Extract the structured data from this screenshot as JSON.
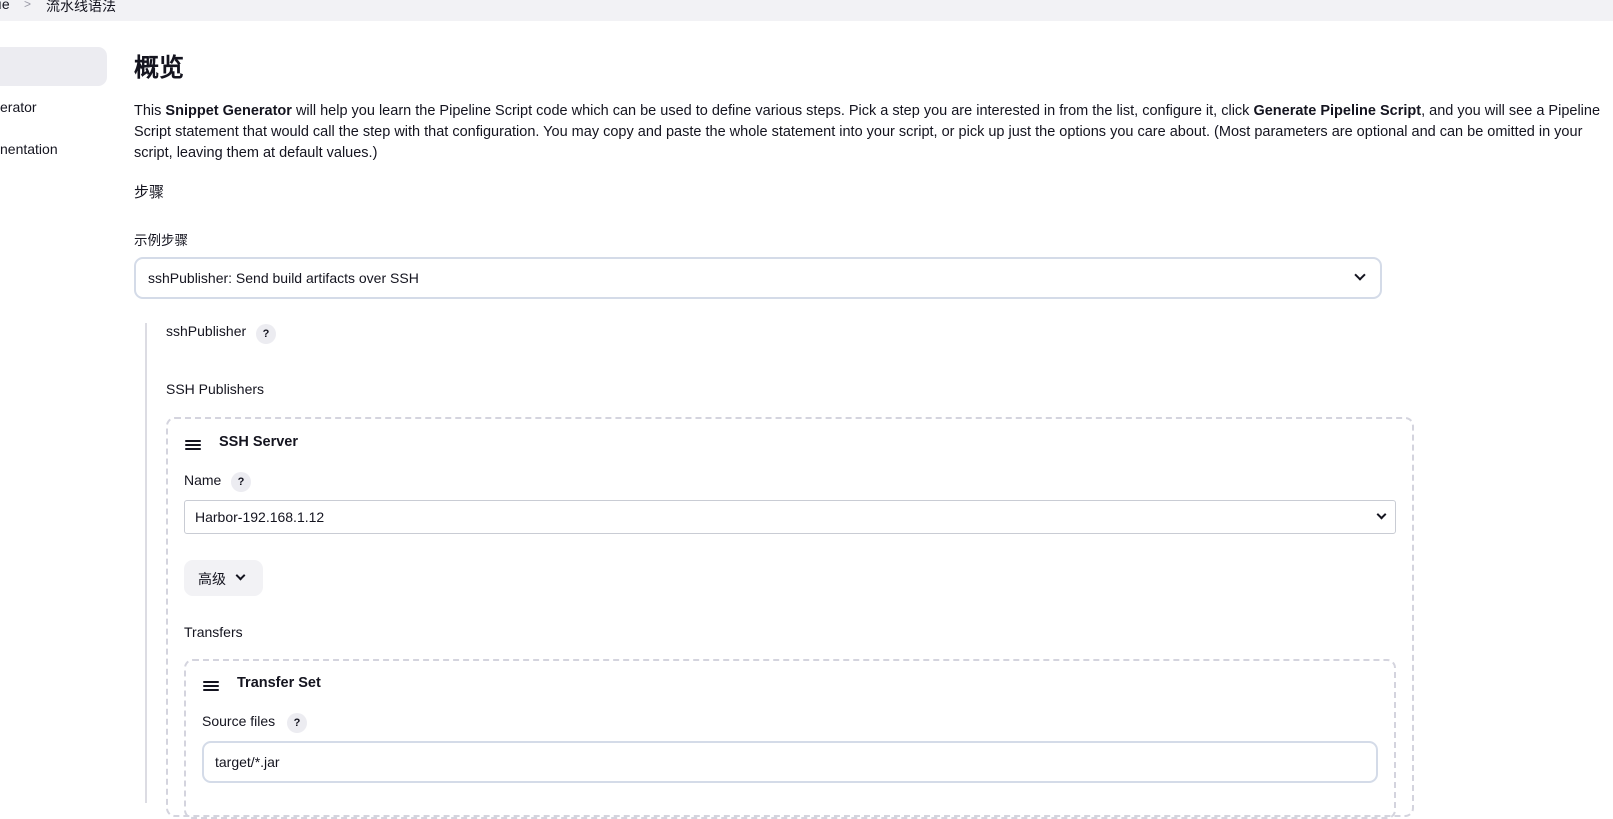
{
  "breadcrumb": {
    "items": [
      "ıe",
      "流水线语法"
    ],
    "separator": ">"
  },
  "sidebar": {
    "items": [
      {
        "label": "",
        "active": true
      },
      {
        "label": "erator"
      },
      {
        "label": "nentation"
      }
    ]
  },
  "main": {
    "title": "概览",
    "intro": {
      "p1": "This ",
      "b1": "Snippet Generator",
      "p2": " will help you learn the Pipeline Script code which can be used to define various steps. Pick a step you are interested in from the list, configure it, click ",
      "b2": "Generate Pipeline Script",
      "p3": ", and you will see a Pipeline Script statement that would call the step with that configuration. You may copy and paste the whole statement into your script, or pick up just the options you care about. (Most parameters are optional and can be omitted in your script, leaving them at default values.)"
    },
    "steps_heading": "步骤",
    "example_step_label": "示例步骤",
    "example_step_value": "sshPublisher: Send build artifacts over SSH",
    "step_name": "sshPublisher",
    "help_glyph": "?",
    "ssh_publishers_label": "SSH Publishers",
    "ssh_server": {
      "title": "SSH Server",
      "name_label": "Name",
      "name_value": "Harbor-192.168.1.12",
      "advanced_label": "高级",
      "transfers_label": "Transfers",
      "transfer_set": {
        "title": "Transfer Set",
        "source_files_label": "Source files",
        "source_files_value": "target/*.jar"
      }
    }
  },
  "icons": {
    "drag_handle": "drag-handle-icon",
    "chevron": "chevron-down-icon",
    "help": "help-icon"
  },
  "colors": {
    "border": "#d4dbe8",
    "dashed_border": "#d4d4de",
    "active_bg": "#ececf1",
    "text": "#14141f"
  }
}
